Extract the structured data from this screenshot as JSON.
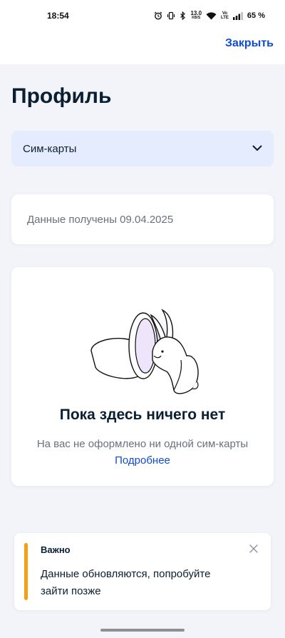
{
  "status_bar": {
    "time": "18:54",
    "net_speed_value": "13.0",
    "net_speed_unit": "KB/S",
    "volte_top": "Vo",
    "volte_bottom": "LTE",
    "battery": "65 %"
  },
  "header": {
    "close_label": "Закрыть"
  },
  "page": {
    "title": "Профиль"
  },
  "selector": {
    "value": "Сим-карты"
  },
  "info": {
    "text": "Данные получены 09.04.2025"
  },
  "empty_state": {
    "title": "Пока здесь ничего нет",
    "description": "На вас не оформлено ни одной сим-карты",
    "link": "Подробнее"
  },
  "notification": {
    "title": "Важно",
    "text": "Данные обновляются, попробуйте зайти позже"
  },
  "colors": {
    "accent": "#0d4cd3",
    "warning": "#f59f17",
    "select_bg": "#e4ecfd",
    "page_bg": "#f2f4f9"
  }
}
